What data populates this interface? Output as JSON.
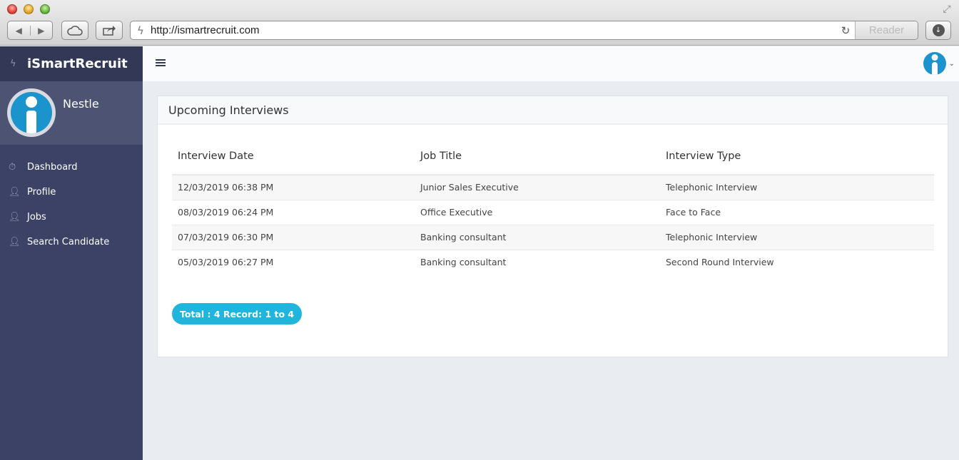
{
  "browser": {
    "url": "http://ismartrecruit.com",
    "reader_label": "Reader"
  },
  "sidebar": {
    "brand": "iSmartRecruit",
    "profile_name": "Nestle",
    "items": [
      {
        "label": "Dashboard",
        "icon": "stopwatch-icon"
      },
      {
        "label": "Profile",
        "icon": "user-icon"
      },
      {
        "label": "Jobs",
        "icon": "user-icon"
      },
      {
        "label": "Search Candidate",
        "icon": "user-icon"
      }
    ]
  },
  "panel": {
    "title": "Upcoming Interviews",
    "columns": [
      "Interview Date",
      "Job Title",
      "Interview Type"
    ],
    "rows": [
      [
        "12/03/2019 06:38 PM",
        "Junior Sales Executive",
        "Telephonic Interview"
      ],
      [
        "08/03/2019 06:24 PM",
        "Office Executive",
        "Face to Face"
      ],
      [
        "07/03/2019 06:30 PM",
        "Banking consultant",
        "Telephonic Interview"
      ],
      [
        "05/03/2019 06:27 PM",
        "Banking consultant",
        "Second Round Interview"
      ]
    ],
    "record_summary": "Total : 4 Record: 1 to 4"
  },
  "colors": {
    "sidebar_bg": "#3b4266",
    "brand_bg": "#323856",
    "accent": "#1fb5dc",
    "logo_blue": "#1b93cc"
  }
}
